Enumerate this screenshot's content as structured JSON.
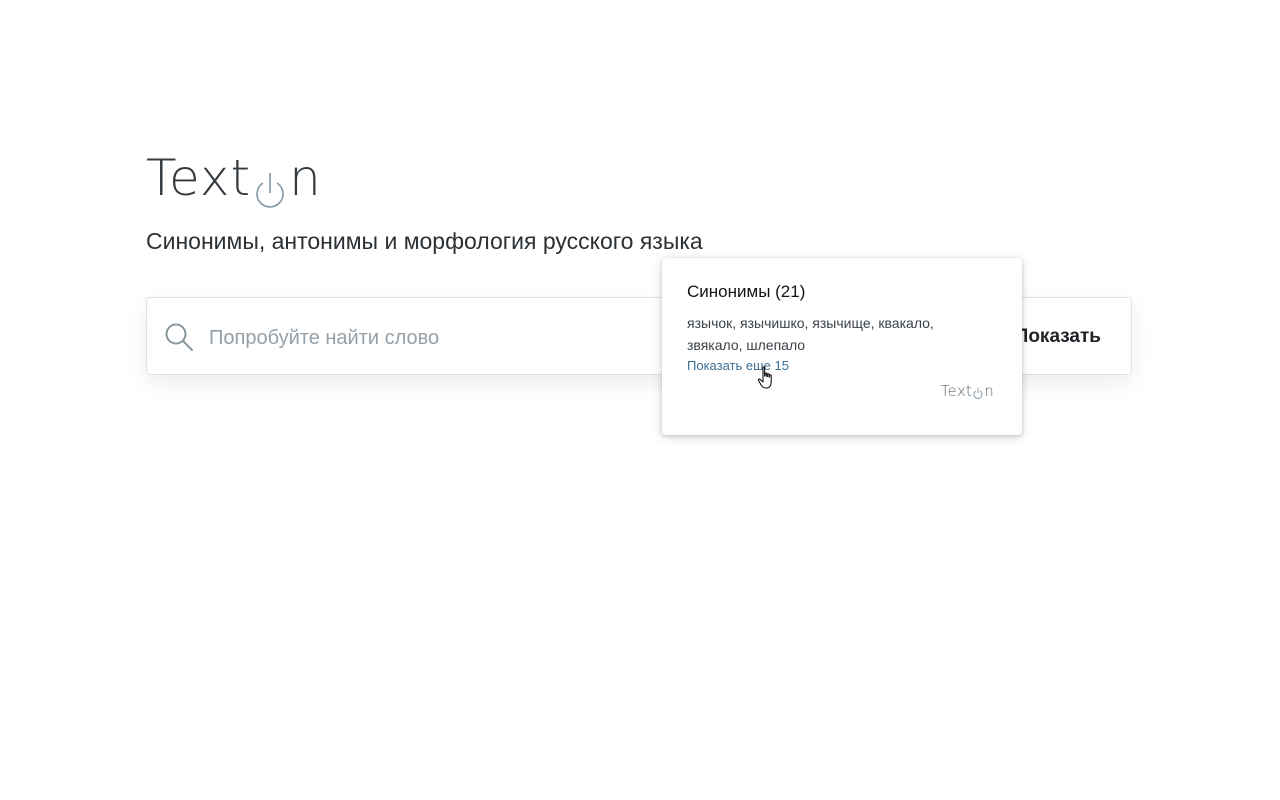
{
  "logo": {
    "text_before": "Text",
    "text_t": "t",
    "text_after": "n"
  },
  "subtitle": "Синонимы, антонимы и морфология русского языка",
  "search": {
    "placeholder": "Попробуйте найти слово",
    "value": "",
    "button_label": "Показать"
  },
  "popup": {
    "title": "Синонимы (21)",
    "words": "язычок, язычишко, язычище, квакало, звякало, шлепало",
    "show_more": "Показать еще 15",
    "logo_before": "Text",
    "logo_after": "n"
  },
  "colors": {
    "accent": "#3d6e93",
    "logo_power": "#7f97a6"
  }
}
